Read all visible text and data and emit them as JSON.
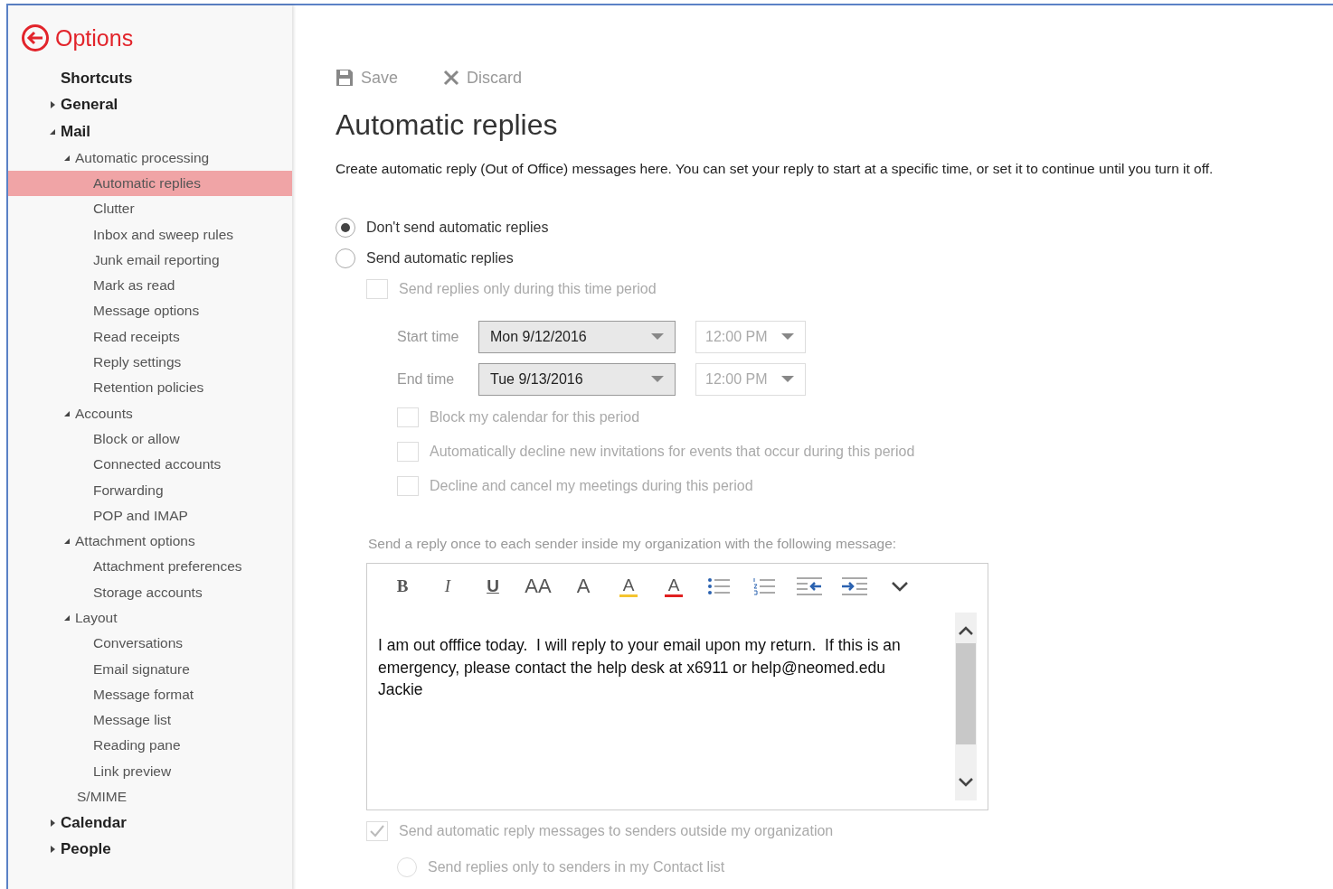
{
  "header": {
    "title": "Options"
  },
  "sidebar": {
    "items": [
      {
        "label": "Shortcuts",
        "selected": false
      },
      {
        "label": "General",
        "expanded": false,
        "selected": false
      },
      {
        "label": "Mail",
        "expanded": true,
        "selected": false,
        "children": [
          {
            "label": "Automatic processing",
            "expanded": true,
            "selected": false,
            "children": [
              {
                "label": "Automatic replies",
                "selected": true
              },
              {
                "label": "Clutter",
                "selected": false
              },
              {
                "label": "Inbox and sweep rules",
                "selected": false
              },
              {
                "label": "Junk email reporting",
                "selected": false
              },
              {
                "label": "Mark as read",
                "selected": false
              },
              {
                "label": "Message options",
                "selected": false
              },
              {
                "label": "Read receipts",
                "selected": false
              },
              {
                "label": "Reply settings",
                "selected": false
              },
              {
                "label": "Retention policies",
                "selected": false
              }
            ]
          },
          {
            "label": "Accounts",
            "expanded": true,
            "selected": false,
            "children": [
              {
                "label": "Block or allow",
                "selected": false
              },
              {
                "label": "Connected accounts",
                "selected": false
              },
              {
                "label": "Forwarding",
                "selected": false
              },
              {
                "label": "POP and IMAP",
                "selected": false
              }
            ]
          },
          {
            "label": "Attachment options",
            "expanded": true,
            "selected": false,
            "children": [
              {
                "label": "Attachment preferences",
                "selected": false
              },
              {
                "label": "Storage accounts",
                "selected": false
              }
            ]
          },
          {
            "label": "Layout",
            "expanded": true,
            "selected": false,
            "children": [
              {
                "label": "Conversations",
                "selected": false
              },
              {
                "label": "Email signature",
                "selected": false
              },
              {
                "label": "Message format",
                "selected": false
              },
              {
                "label": "Message list",
                "selected": false
              },
              {
                "label": "Reading pane",
                "selected": false
              },
              {
                "label": "Link preview",
                "selected": false
              }
            ]
          },
          {
            "label": "S/MIME",
            "selected": false
          }
        ]
      },
      {
        "label": "Calendar",
        "expanded": false,
        "selected": false
      },
      {
        "label": "People",
        "expanded": false,
        "selected": false
      }
    ]
  },
  "toolbar": [
    {
      "kind": "save",
      "label": "Save",
      "disabled": true
    },
    {
      "kind": "discard",
      "label": "Discard",
      "disabled": true
    }
  ],
  "page": {
    "title": "Automatic replies",
    "description": "Create automatic reply (Out of Office) messages here. You can set your reply to start at a specific time, or set it to continue until you turn it off."
  },
  "reply_mode": [
    {
      "label": "Don't send automatic replies",
      "selected": true
    },
    {
      "label": "Send automatic replies",
      "selected": false
    }
  ],
  "time_period": {
    "label": "Send replies only during this time period",
    "checked": false,
    "disabled": true
  },
  "times": [
    {
      "label": "Start time",
      "date": "Mon 9/12/2016",
      "time": "12:00 PM"
    },
    {
      "label": "End time",
      "date": "Tue 9/13/2016",
      "time": "12:00 PM"
    }
  ],
  "period_options": [
    {
      "label": "Block my calendar for this period",
      "checked": false,
      "disabled": true
    },
    {
      "label": "Automatically decline new invitations for events that occur during this period",
      "checked": false,
      "disabled": true
    },
    {
      "label": "Decline and cancel my meetings during this period",
      "checked": false,
      "disabled": true
    }
  ],
  "inside_message": {
    "label": "Send a reply once to each sender inside my organization with the following message:",
    "format_tools": [
      {
        "kind": "bold",
        "label": "B"
      },
      {
        "kind": "italic",
        "label": "I"
      },
      {
        "kind": "underline",
        "label": "U"
      },
      {
        "kind": "font-size",
        "label": "AA"
      },
      {
        "kind": "grow-font",
        "label": "A"
      },
      {
        "kind": "highlight",
        "label": "A"
      },
      {
        "kind": "font-color",
        "label": "A"
      },
      {
        "kind": "bullets"
      },
      {
        "kind": "numbering"
      },
      {
        "kind": "outdent"
      },
      {
        "kind": "indent"
      },
      {
        "kind": "more"
      }
    ],
    "lines": [
      "I am out offfice today.  I will reply to your email upon my return.  If this is an emergency, please contact the help desk at x6911 or help@neomed.edu",
      "Jackie"
    ]
  },
  "outside": {
    "label": "Send automatic reply messages to senders outside my organization",
    "checked": true,
    "disabled": true
  },
  "outside_options": [
    {
      "label": "Send replies only to senders in my Contact list",
      "selected": false,
      "disabled": true
    }
  ]
}
